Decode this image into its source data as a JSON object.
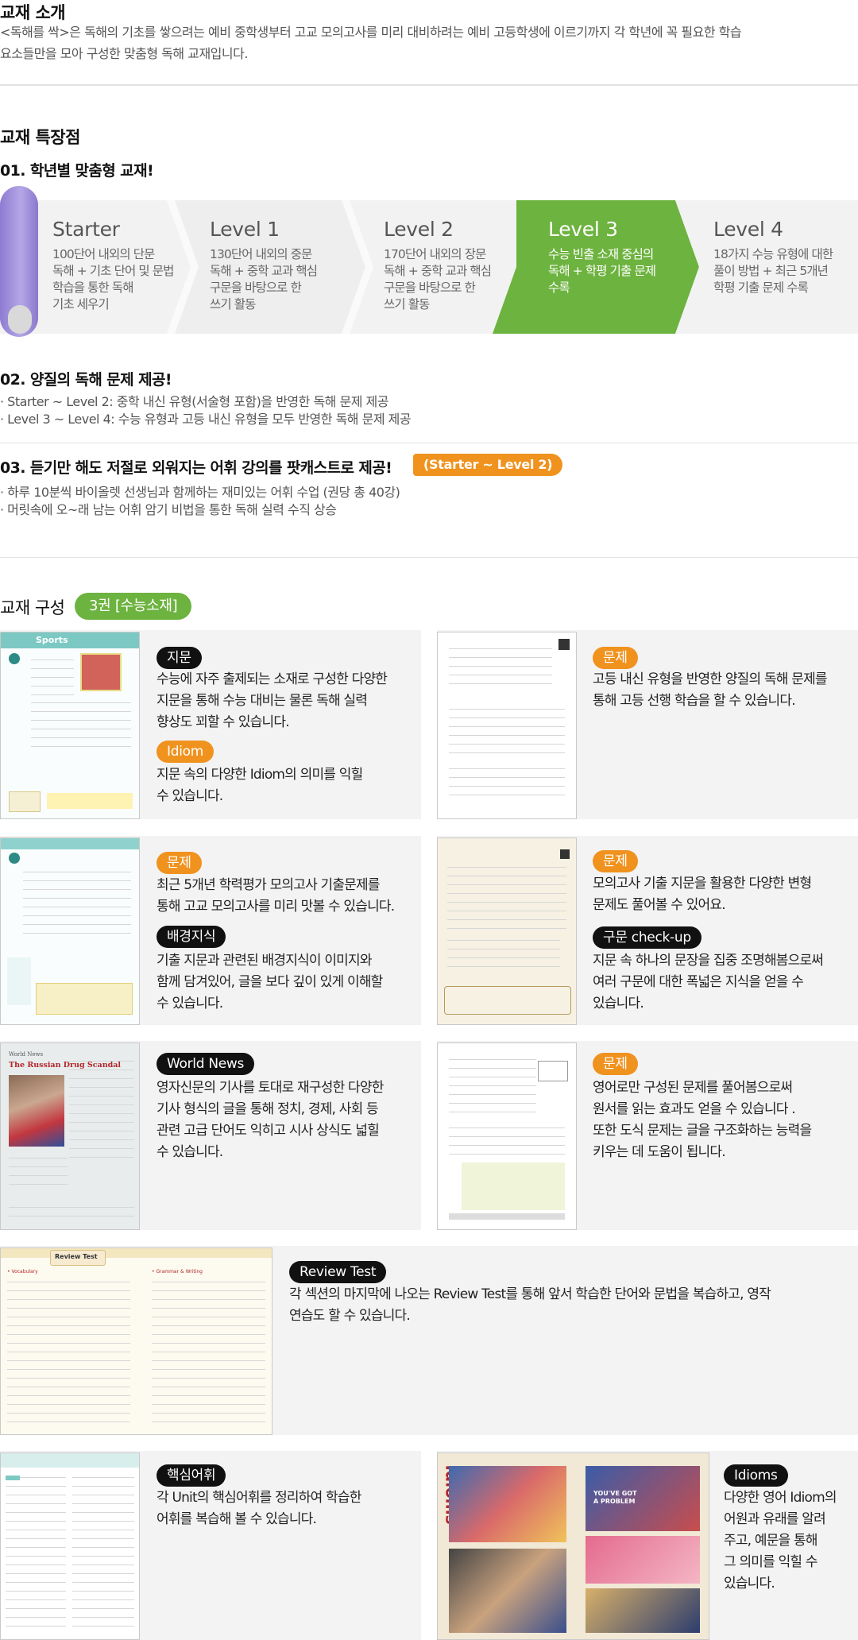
{
  "intro": {
    "title": "교재 소개",
    "text": "<독해를 싹>은 독해의 기초를 쌓으려는 예비 중학생부터 고교 모의고사를 미리 대비하려는 예비 고등학생에 이르기까지 각 학년에 꼭 필요한 학습\n요소들만을 모아 구성한 맞춤형 독해 교재입니다."
  },
  "features": {
    "title": "교재 특장점",
    "f1_title": "01. 학년별 맞춤형 교재!",
    "levels": [
      {
        "name": "Starter",
        "desc": "100단어 내외의 단문\n독해 + 기초 단어 및 문법\n학습을 통한 독해\n기초 세우기"
      },
      {
        "name": "Level 1",
        "desc": "130단어 내외의 중문\n독해 + 중학 교과 핵심\n구문을 바탕으로 한\n쓰기 활동"
      },
      {
        "name": "Level 2",
        "desc": "170단어 내외의 장문\n독해 + 중학 교과 핵심\n구문을 바탕으로 한\n쓰기 활동"
      },
      {
        "name": "Level 3",
        "desc": "수능 빈출 소재 중심의\n독해 + 학평 기출 문제\n수록"
      },
      {
        "name": "Level 4",
        "desc": "18가지 수능 유형에 대한\n풀이 방법 + 최근 5개년\n학평 기출 문제 수록"
      }
    ],
    "f2_title": "02. 양질의 독해 문제 제공!",
    "f2_items": [
      "· Starter ~ Level 2: 중학 내신 유형(서술형 포함)을 반영한 독해 문제 제공",
      "· Level 3 ~ Level 4: 수능 유형과 고등 내신 유형을 모두 반영한 독해 문제 제공"
    ],
    "f3_title": "03. 듣기만 해도 저절로 외워지는 어휘 강의를 팟캐스트로 제공!",
    "f3_badge": "(Starter ~ Level 2)",
    "f3_items": [
      "· 하루 10분씩 바이올렛 선생님과 함께하는 재미있는 어휘 수업 (권당 총 40강)",
      "· 머릿속에 오~래 남는 어휘 암기 비법을 통한 독해 실력 수직 상승"
    ]
  },
  "composition": {
    "title": "교재 구성",
    "badge": "3권 [수능소재]",
    "c1": {
      "tag1": "지문",
      "text1": "수능에 자주 출제되는 소재로 구성한 다양한\n지문을 통해 수능 대비는 물론 독해 실력\n향상도 꾀할 수 있습니다.",
      "tag2": "Idiom",
      "text2": "지문 속의 다양한 Idiom의 의미를 익힐\n수 있습니다.",
      "book_head": "Sports"
    },
    "c2": {
      "tag": "문제",
      "text": "고등 내신 유형을 반영한 양질의 독해 문제를\n통해 고등 선행 학습을 할 수 있습니다."
    },
    "c3": {
      "tag1": "문제",
      "text1": "최근 5개년 학력평가 모의고사 기출문제를\n통해 고교 모의고사를 미리 맛볼 수 있습니다.",
      "tag2": "배경지식",
      "text2": "기출 지문과 관련된 배경지식이 이미지와\n함께 담겨있어, 글을 보다 깊이 있게 이해할\n수 있습니다."
    },
    "c4": {
      "tag1": "문제",
      "text1": "모의고사 기출 지문을 활용한 다양한 변형\n문제도 풀어볼 수 있어요.",
      "tag2": "구문 check-up",
      "text2": "지문 속 하나의 문장을 집중 조명해봄으로써\n여러 구문에 대한 폭넓은 지식을 얻을 수\n있습니다."
    },
    "c5": {
      "tag": "World News",
      "text": "영자신문의 기사를 토대로 재구성한 다양한\n기사 형식의 글을 통해 정치, 경제, 사회 등\n관련 고급 단어도 익히고 시사 상식도 넓힐\n수 있습니다.",
      "book_small": "World News",
      "book_title": "The Russian Drug Scandal"
    },
    "c6": {
      "tag": "문제",
      "text": "영어로만 구성된 문제를 풀어봄으로써\n원서를 읽는 효과도 얻을 수 있습니다 .\n또한 도식 문제는 글을 구조화하는 능력을\n키우는 데 도움이 됩니다."
    },
    "c7": {
      "tag": "Review Test",
      "text": "각 섹션의 마지막에 나오는 Review Test를 통해 앞서 학습한 단어와 문법을 복습하고, 영작\n연습도 할 수 있습니다.",
      "book_head": "Review Test",
      "book_left": "• Vocabulary",
      "book_right": "• Grammar & Writing"
    },
    "c8": {
      "tag": "핵심어휘",
      "text": "각 Unit의 핵심어휘를 정리하여 학습한\n어휘를 복습해 볼 수 있습니다."
    },
    "c9": {
      "tag": "Idioms",
      "text": "다양한 영어 Idiom의\n어원과 유래를 알려\n주고, 예문을 통해\n그 의미를 익힐 수\n있습니다.",
      "book_vert": "Idioms",
      "book_caption": "YOU'VE GOT A PROBLEM"
    }
  },
  "colors": {
    "green": "#6db33f",
    "orange": "#f0921e",
    "purple": "#9d8bd8",
    "black": "#111111"
  }
}
